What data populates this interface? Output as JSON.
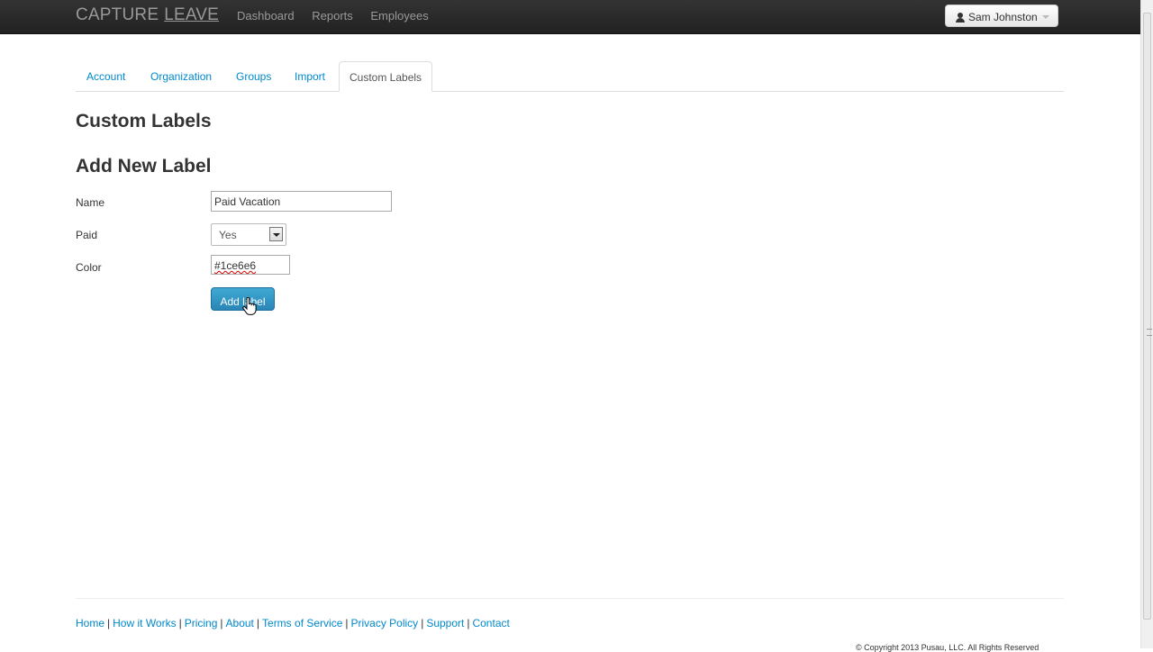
{
  "navbar": {
    "brand_part1": "CAPTURE",
    "brand_part2": "LEAVE",
    "links": [
      "Dashboard",
      "Reports",
      "Employees"
    ],
    "user_name": "Sam Johnston"
  },
  "tabs": [
    "Account",
    "Organization",
    "Groups",
    "Import",
    "Custom Labels"
  ],
  "active_tab": "Custom Labels",
  "page_title": "Custom Labels",
  "form": {
    "title": "Add New Label",
    "name_label": "Name",
    "name_value": "Paid Vacation",
    "paid_label": "Paid",
    "paid_value": "Yes",
    "color_label": "Color",
    "color_value": "#1ce6e6",
    "submit_label": "Add label"
  },
  "footer": {
    "links": [
      "Home",
      "How it Works",
      "Pricing",
      "About",
      "Terms of Service",
      "Privacy Policy",
      "Support",
      "Contact"
    ],
    "separator": "|",
    "copyright": "© Copyright 2013 Pusau, LLC. All Rights Reserved"
  },
  "colors": {
    "navbar": "#222222",
    "link": "#0088cc",
    "primary_button": "#2f96c4"
  }
}
